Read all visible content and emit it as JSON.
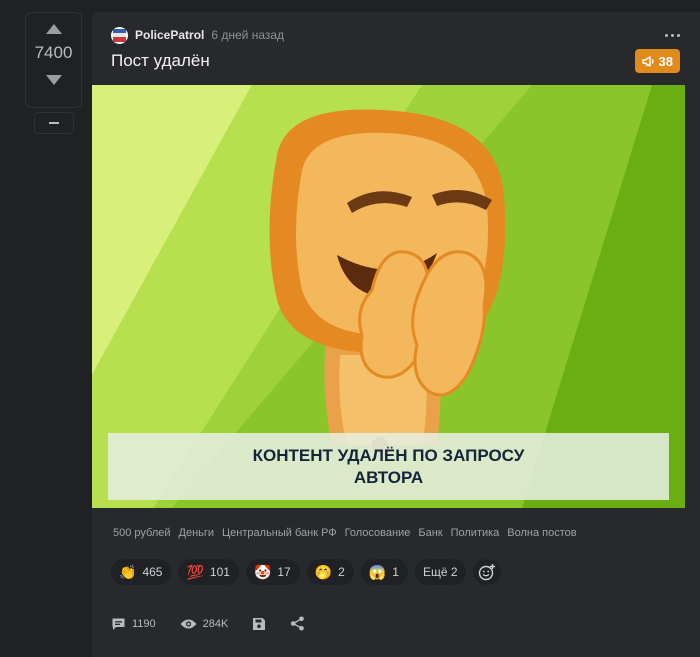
{
  "vote": {
    "count": "7400"
  },
  "post": {
    "author": "PolicePatrol",
    "time_ago": "6 дней назад",
    "title": "Пост удалён",
    "badge_count": "38",
    "image_caption": "КОНТЕНТ УДАЛЁН ПО ЗАПРОСУ АВТОРА"
  },
  "tags": [
    "500 рублей",
    "Деньги",
    "Центральный банк РФ",
    "Голосование",
    "Банк",
    "Политика",
    "Волна постов"
  ],
  "reactions": [
    {
      "emoji": "👏",
      "count": "465"
    },
    {
      "emoji": "💯",
      "count": "101"
    },
    {
      "emoji": "🤡",
      "count": "17"
    },
    {
      "emoji": "🤭",
      "count": "2"
    },
    {
      "emoji": "😱",
      "count": "1"
    }
  ],
  "reactions_more": "Ещё 2",
  "footer": {
    "comments": "1190",
    "views": "284K"
  },
  "colors": {
    "accent": "#e18b1d",
    "card": "#27292d",
    "background": "#1f2124"
  }
}
